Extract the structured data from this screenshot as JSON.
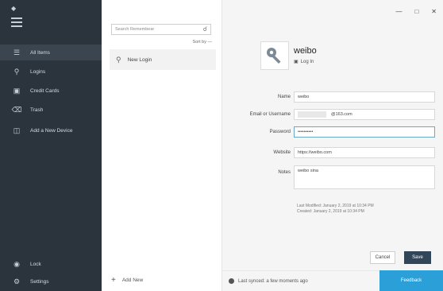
{
  "sidebar": {
    "items": [
      {
        "icon": "list-icon",
        "label": "All Items"
      },
      {
        "icon": "key-icon",
        "label": "Logins"
      },
      {
        "icon": "card-icon",
        "label": "Credit Cards"
      },
      {
        "icon": "trash-icon",
        "label": "Trash"
      },
      {
        "icon": "device-icon",
        "label": "Add a New Device"
      }
    ],
    "bottom": [
      {
        "icon": "lock-icon",
        "label": "Lock"
      },
      {
        "icon": "gear-icon",
        "label": "Settings"
      }
    ]
  },
  "list": {
    "search_placeholder": "Search Remembear",
    "sort_label": "Sort by —",
    "entries": [
      {
        "label": "New Login",
        "icon": "key-icon"
      }
    ],
    "add_label": "Add New"
  },
  "detail": {
    "title": "weibo",
    "login_link": "Log In",
    "fields": {
      "name_label": "Name",
      "name_value": "weibo",
      "email_label": "Email or Username",
      "email_value": "@163.com",
      "password_label": "Password",
      "password_value": "••••••••••",
      "website_label": "Website",
      "website_value": "https://weibo.com",
      "notes_label": "Notes",
      "notes_value": "weibo sina"
    },
    "meta_created": "Last Modified: January 2, 2019 at 10:34 PM",
    "meta_updated": "Created: January 2, 2019 at 10:34 PM",
    "cancel_label": "Cancel",
    "save_label": "Save"
  },
  "status": {
    "sync_text": "Last synced: a few moments ago",
    "feedback_label": "Feedback"
  },
  "colors": {
    "sidebar_bg": "#2b333d",
    "sidebar_active": "#3a4550",
    "save_btn": "#32465a",
    "feedback_btn": "#2a9fd8"
  }
}
